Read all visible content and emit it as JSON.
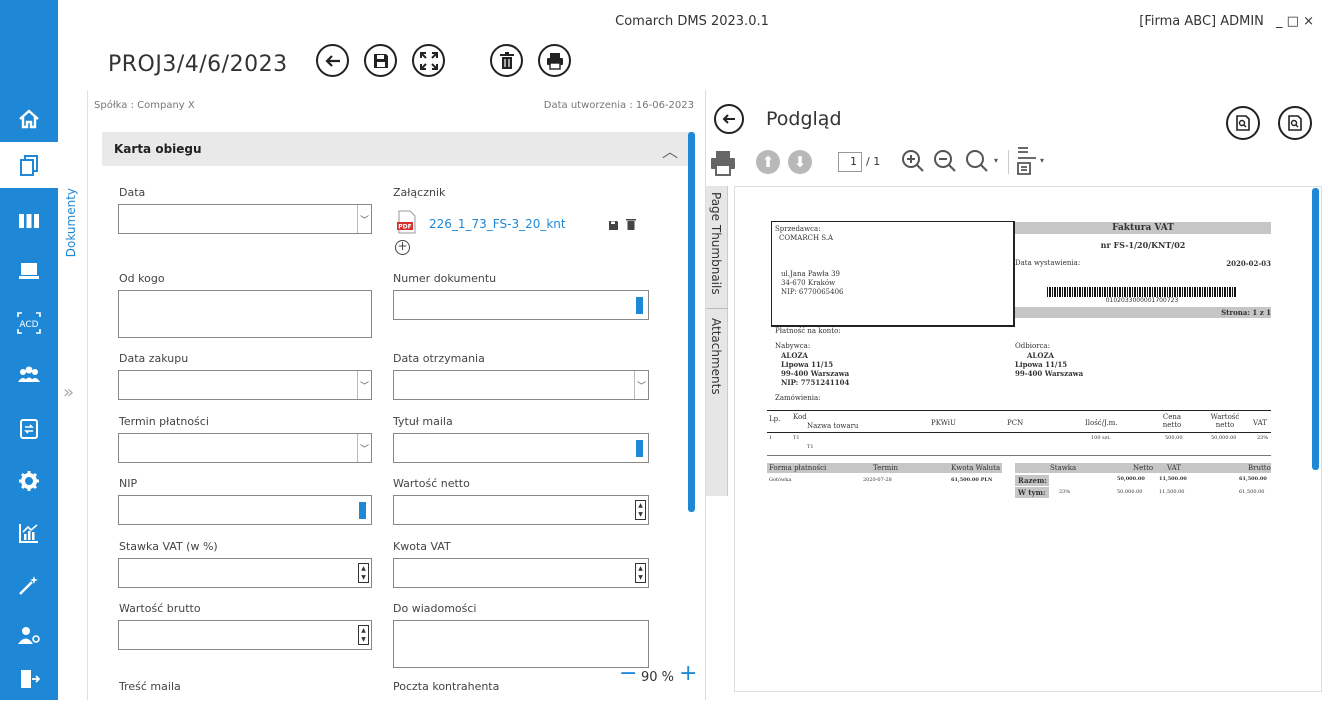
{
  "app": {
    "title": "Comarch DMS 2023.0.1",
    "window_info": "[Firma ABC]  ADMIN",
    "window_controls": "_ □ ×"
  },
  "document": {
    "title": "PROJ3/4/6/2023",
    "tab_label": "Dokumenty"
  },
  "sidebar": {
    "items": [
      "home-icon",
      "documents-icon",
      "workflow-icon",
      "computer-icon",
      "ocr-acd-icon",
      "users-icon",
      "document-exchange-icon",
      "settings-icon",
      "reports-icon",
      "wizard-icon",
      "admin-icon",
      "logout-icon"
    ]
  },
  "form": {
    "company": "Spółka : Company X",
    "created": "Data utworzenia : 16-06-2023",
    "section_title": "Karta obiegu",
    "labels": {
      "data": "Data",
      "zalacznik": "Załącznik",
      "od_kogo": "Od kogo",
      "numer": "Numer dokumentu",
      "data_zakupu": "Data zakupu",
      "data_otrzymania": "Data otrzymania",
      "termin": "Termin płatności",
      "tytul": "Tytuł maila",
      "nip": "NIP",
      "netto": "Wartość netto",
      "stawka": "Stawka VAT (w %)",
      "kwota_vat": "Kwota VAT",
      "brutto": "Wartość brutto",
      "do_wiadomosci": "Do wiadomości",
      "tresc": "Treść maila",
      "poczta": "Poczta kontrahenta"
    },
    "attachment": {
      "name": "226_1_73_FS-3_20_knt",
      "type": "PDF"
    },
    "zoom": "90 %"
  },
  "preview": {
    "title": "Podgląd",
    "page_current": "1",
    "page_total": "/ 1",
    "side_tabs": [
      "Page Thumbnails",
      "Attachments"
    ],
    "invoice": {
      "seller_label": "Sprzedawca:",
      "seller_name": "COMARCH S.A",
      "seller_street": "ul.Jana Pawła 39",
      "seller_city": "34-670 Kraków",
      "seller_nip": "NIP: 6770065406",
      "title": "Faktura VAT",
      "number": "nr FS-1/20/KNT/02",
      "issue_label": "Data wystawienia:",
      "issue_date": "2020-02-03",
      "barcode_text": "0102033000001700723",
      "page": "Strona: 1 z 1",
      "payment": "Płatność na konto:",
      "buyer_label": "Nabywca:",
      "buyer_name": "ALOZA",
      "buyer_street": "Lipowa 11/15",
      "buyer_city": "99-400  Warszawa",
      "buyer_nip": "NIP: 7751241104",
      "receiver_label": "Odbiorca:",
      "receiver_name": "ALOZA",
      "receiver_street": "Lipowa 11/15",
      "receiver_city": "99-400  Warszawa",
      "orders": "Zamówienia:",
      "cols": {
        "lp": "Lp.",
        "kod": "Kod",
        "nazwa": "Nazwa towaru",
        "pkwiu": "PKWiU",
        "pcn": "PCN",
        "ilosc": "Ilość/J.m.",
        "cena": "Cena netto",
        "wartosc": "Wartość netto",
        "vat": "VAT"
      },
      "row": {
        "lp": "1",
        "kod": "T1",
        "nazwa": "T1",
        "ilosc": "100 szt.",
        "cena": "500,00",
        "wartosc": "50,000.00",
        "vat": "23%"
      },
      "pay_cols": {
        "forma": "Forma płatności",
        "termin": "Termin",
        "kwota": "Kwota Waluta"
      },
      "pay_row": {
        "forma": "Gotówka",
        "termin": "2020-07-28",
        "kwota": "61,500.00 PLN"
      },
      "sum_cols": {
        "stawka": "Stawka",
        "netto": "Netto",
        "vat": "VAT",
        "brutto": "Brutto"
      },
      "sum_razem": {
        "label": "Razem:",
        "netto": "50,000.00",
        "vat": "11,500.00",
        "brutto": "61,500.00"
      },
      "sum_wtym": {
        "label": "W tym:",
        "stawka": "23%",
        "netto": "50,000.00",
        "vat": "11,500.00",
        "brutto": "61,500.00"
      }
    }
  }
}
